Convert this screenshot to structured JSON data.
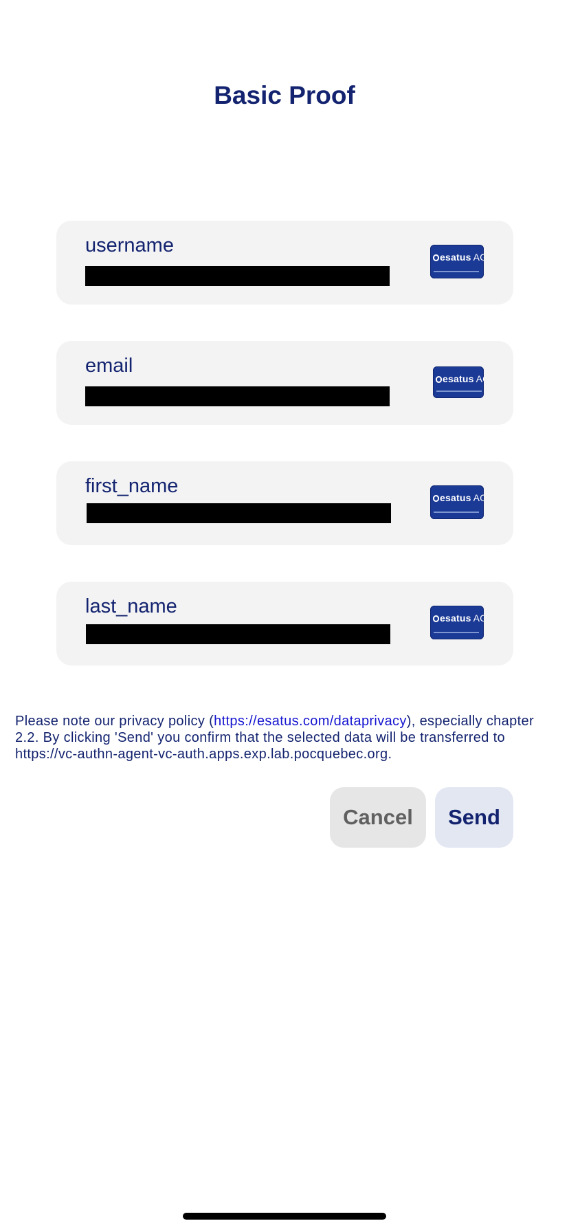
{
  "title": "Basic Proof",
  "attributes": [
    {
      "label": "username"
    },
    {
      "label": "email"
    },
    {
      "label": "first_name"
    },
    {
      "label": "last_name"
    }
  ],
  "issuer_logo": {
    "name": "esatus",
    "suffix": "AG",
    "brand_color": "#1b3a96",
    "icon": "issuer-logo"
  },
  "notice": {
    "before_link": "Please note our privacy policy (",
    "link_text": "https://esatus.com/dataprivacy",
    "after_link": "), especially chapter 2.2. By clicking 'Send' you confirm that the selected data will be transferred to https://vc-authn-agent-vc-auth.apps.exp.lab.pocquebec.org."
  },
  "buttons": {
    "cancel_label": "Cancel",
    "send_label": "Send"
  },
  "colors": {
    "primary_text": "#13236f",
    "link": "#1515d0",
    "card_bg": "#f3f3f4",
    "redaction": "#000000"
  }
}
